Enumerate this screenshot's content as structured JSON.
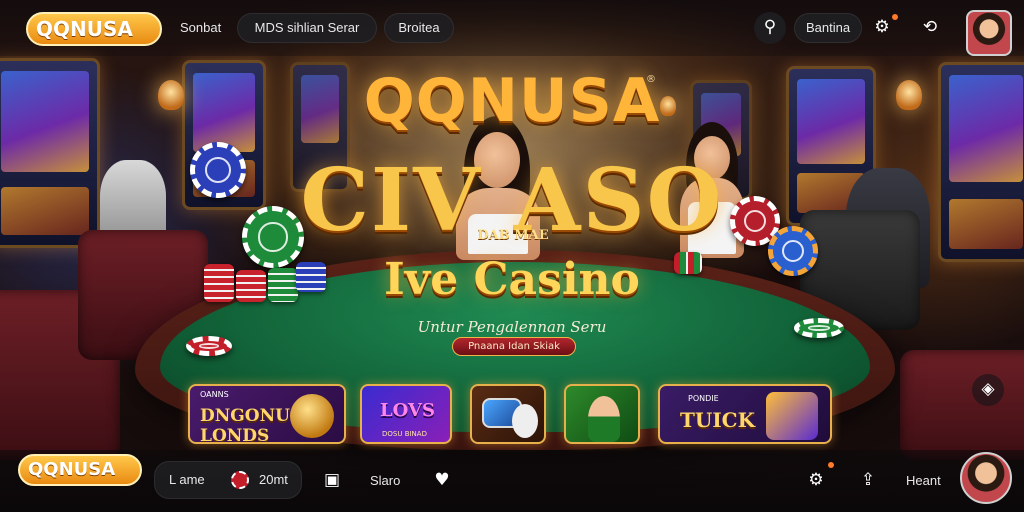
{
  "header": {
    "logo_text": "QQNUSA",
    "nav": [
      "Sonbat",
      "MDS sihlian  Serar",
      "Broitea"
    ],
    "right_label": "Bantina",
    "pin_icon": "location-pin-icon",
    "settings_icon": "gear-icon",
    "refresh_icon": "refresh-icon"
  },
  "hero": {
    "brand": "QQNUSA",
    "reg_mark": "®",
    "title": "CIV  ASO",
    "title_sub": "DAB MAE",
    "live_title": "Ive Casino",
    "tagline": "Untur Pengalennan Seru",
    "cta": "Pnaana Idan Skiak"
  },
  "games": [
    {
      "label": "DNGONU LONDS",
      "caption": "OANNS"
    },
    {
      "label": "LOVS",
      "caption": "DOSU BINAD"
    },
    {
      "label": "",
      "caption": ""
    },
    {
      "label": "",
      "caption": ""
    },
    {
      "label": "TUICK",
      "caption": "PONDIE"
    }
  ],
  "footer": {
    "logo_text": "QQNUSA",
    "home_label": "L ame",
    "score": "20mt",
    "chat_icon": "chat-icon",
    "slots_label": "Slaro",
    "heart_icon": "heart-icon",
    "gear_icon": "gear-icon",
    "share_icon": "share-icon",
    "right_label": "Heant"
  },
  "colors": {
    "gold": "#ffcf4a",
    "felt": "#0f5a33",
    "accent": "#e98a12"
  }
}
